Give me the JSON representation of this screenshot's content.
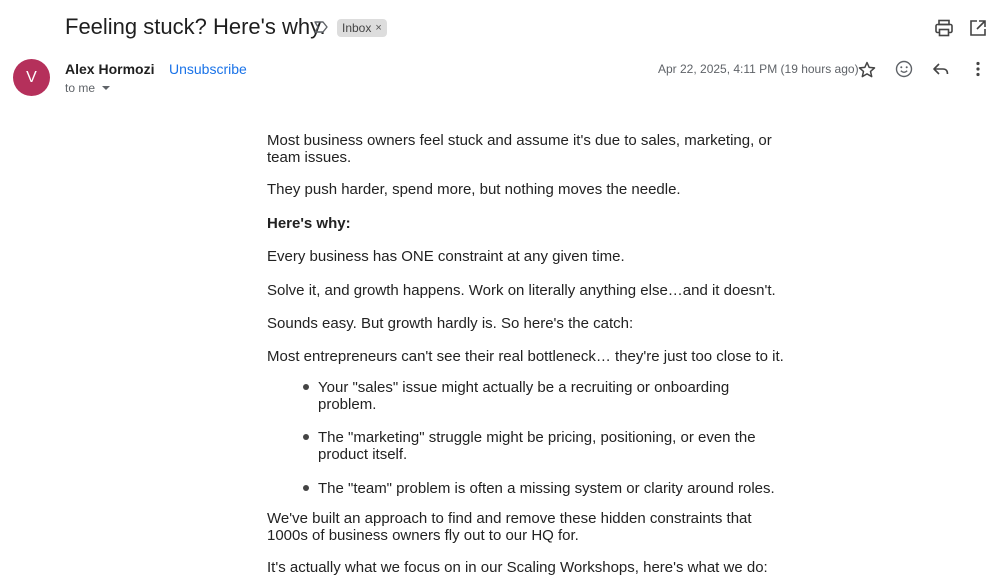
{
  "header": {
    "subject": "Feeling stuck? Here's why.",
    "label_chip": "Inbox",
    "label_chip_remove": "×"
  },
  "message": {
    "avatar_letter": "V",
    "avatar_color": "#b5305b",
    "sender": "Alex Hormozi",
    "unsubscribe": "Unsubscribe",
    "recipient": "to me",
    "date": "Apr 22, 2025, 4:11 PM (19 hours ago)"
  },
  "body": {
    "p1": "Most business owners feel stuck and assume it's due to sales, marketing, or team issues.",
    "p2": "They push harder, spend more, but nothing moves the needle.",
    "p3": "Here's why:",
    "p4": "Every business has ONE constraint at any given time.",
    "p5": "Solve it, and growth happens. Work on literally anything else…and it doesn't.",
    "p6": "Sounds easy. But growth hardly is. So here's the catch:",
    "p7": "Most entrepreneurs can't see their real bottleneck… they're just too close to it.",
    "bullets": [
      "Your \"sales\" issue might actually be a recruiting or onboarding problem.",
      "The \"marketing\" struggle might be pricing, positioning, or even the product itself.",
      "The \"team\" problem is often a missing system or clarity around roles."
    ],
    "p8": "We've built an approach to find and remove these hidden constraints that 1000s of business owners fly out to our HQ for.",
    "p9": "It's actually what we focus on in our Scaling Workshops, here's what we do:"
  },
  "icons": {
    "label": "label-outline-icon",
    "print": "print-icon",
    "open_new": "open-in-new-window-icon",
    "star": "star-icon",
    "emoji": "emoji-reaction-icon",
    "reply": "reply-icon",
    "more": "more-vert-icon"
  }
}
